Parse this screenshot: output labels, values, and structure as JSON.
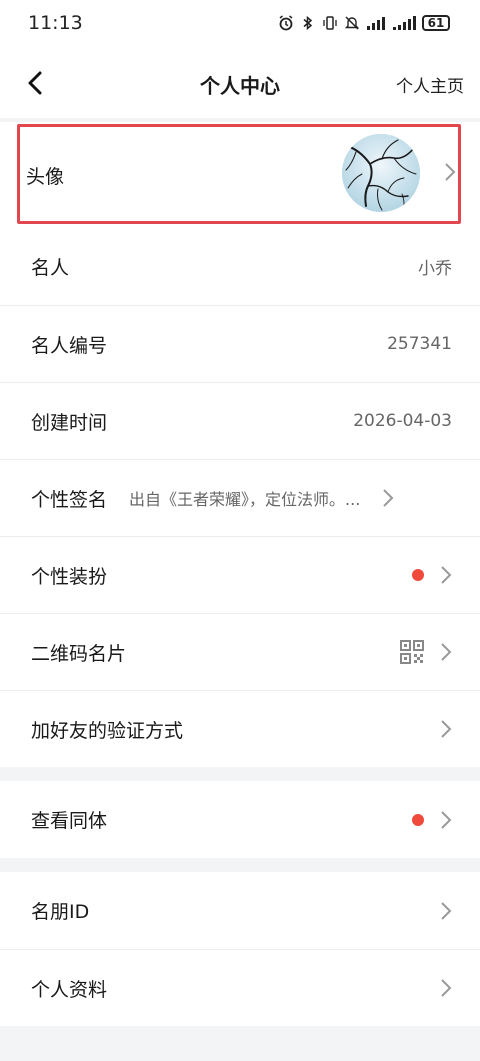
{
  "status_bar": {
    "time": "11:13",
    "battery": "61"
  },
  "header": {
    "title": "个人中心",
    "right_link": "个人主页"
  },
  "avatar_row": {
    "label": "头像"
  },
  "rows": {
    "name": {
      "label": "名人",
      "value": "小乔"
    },
    "number": {
      "label": "名人编号",
      "value": "257341"
    },
    "created": {
      "label": "创建时间",
      "value": "2026-04-03"
    },
    "signature": {
      "label": "个性签名",
      "value": "出自《王者荣耀》，定位法师。..."
    },
    "outfit": {
      "label": "个性装扮"
    },
    "qrcode": {
      "label": "二维码名片"
    },
    "verify": {
      "label": "加好友的验证方式"
    },
    "same_body": {
      "label": "查看同体"
    },
    "friend_id": {
      "label": "名朋ID"
    },
    "profile": {
      "label": "个人资料"
    }
  },
  "colors": {
    "red_dot": "#ef4a3c",
    "highlight_border": "#e2464f",
    "page_bg": "#f3f4f6"
  }
}
